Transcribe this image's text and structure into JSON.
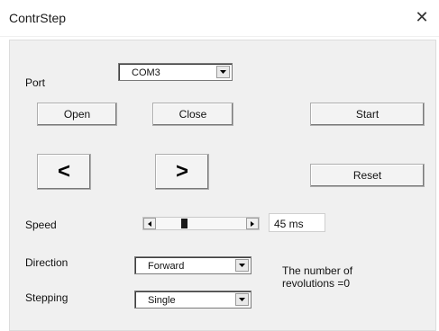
{
  "window": {
    "title": "ContrStep",
    "close_glyph": "✕"
  },
  "port": {
    "label": "Port",
    "value": "COM3"
  },
  "buttons": {
    "open": "Open",
    "close": "Close",
    "start": "Start",
    "reset": "Reset",
    "step_back": "<",
    "step_forward": ">"
  },
  "speed": {
    "label": "Speed",
    "value_text": "45 ms",
    "slider_level": 0.3
  },
  "direction": {
    "label": "Direction",
    "value": "Forward"
  },
  "stepping": {
    "label": "Stepping",
    "value": "Single"
  },
  "revolutions": {
    "line1": "The number of",
    "line2": "revolutions =0"
  },
  "icons": {
    "close": "close-icon",
    "dropdown": "chevron-down-icon",
    "scroll_left": "triangle-left-icon",
    "scroll_right": "triangle-right-icon"
  }
}
